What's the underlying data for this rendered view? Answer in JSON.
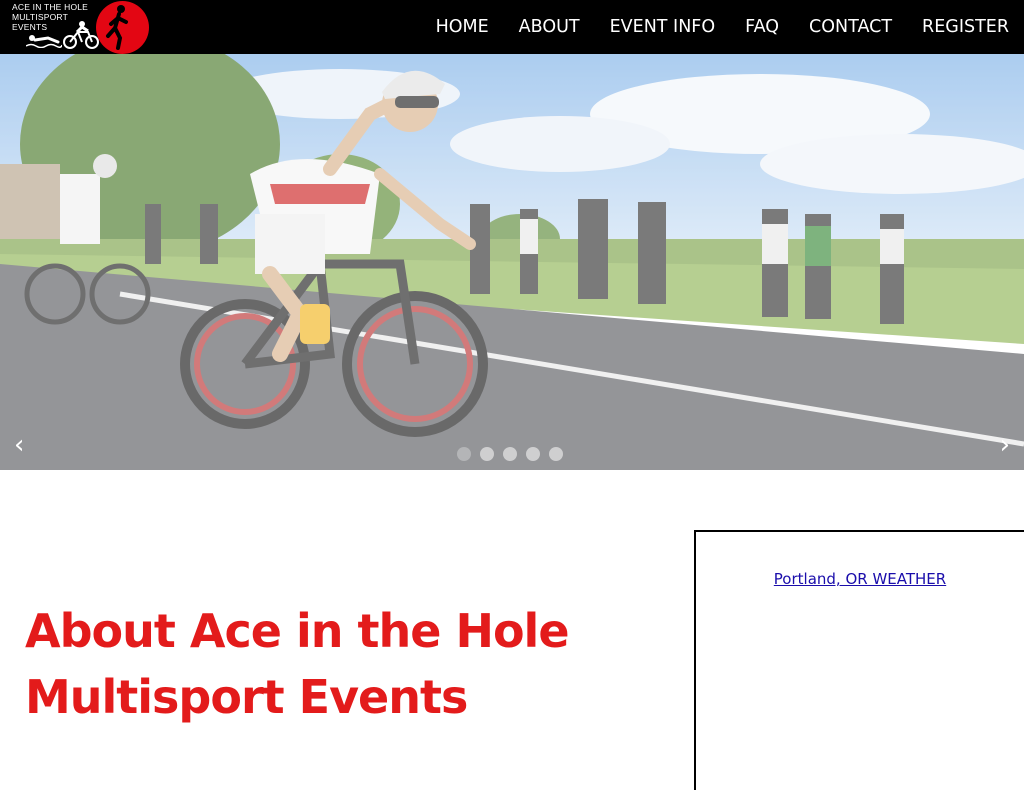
{
  "logo": {
    "line1": "ACE IN THE HOLE",
    "line2": "MULTISPORT",
    "line3": "EVENTS"
  },
  "nav": {
    "items": [
      "HOME",
      "ABOUT",
      "EVENT INFO",
      "FAQ",
      "CONTACT",
      "REGISTER"
    ]
  },
  "carousel": {
    "prev_icon": "‹",
    "next_icon": "›",
    "slide_count": 5,
    "active_index": 0
  },
  "about": {
    "title_line1": "About Ace in the Hole",
    "title_line2": "Multisport Events"
  },
  "weather": {
    "link_text": "Portland, OR WEATHER"
  },
  "colors": {
    "header_bg": "#000000",
    "brand_red": "#e31b1b",
    "link": "#1a0dab"
  }
}
